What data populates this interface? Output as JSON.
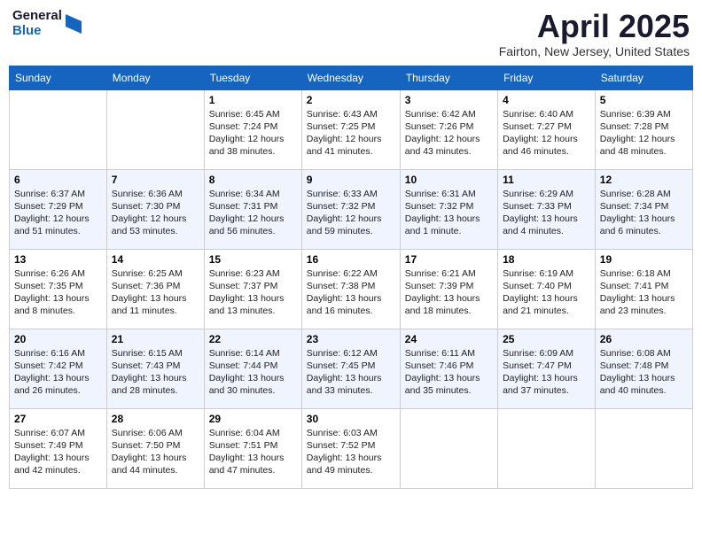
{
  "header": {
    "logo_general": "General",
    "logo_blue": "Blue",
    "title": "April 2025",
    "location": "Fairton, New Jersey, United States"
  },
  "days_of_week": [
    "Sunday",
    "Monday",
    "Tuesday",
    "Wednesday",
    "Thursday",
    "Friday",
    "Saturday"
  ],
  "weeks": [
    [
      {
        "day": "",
        "sunrise": "",
        "sunset": "",
        "daylight": ""
      },
      {
        "day": "",
        "sunrise": "",
        "sunset": "",
        "daylight": ""
      },
      {
        "day": "1",
        "sunrise": "Sunrise: 6:45 AM",
        "sunset": "Sunset: 7:24 PM",
        "daylight": "Daylight: 12 hours and 38 minutes."
      },
      {
        "day": "2",
        "sunrise": "Sunrise: 6:43 AM",
        "sunset": "Sunset: 7:25 PM",
        "daylight": "Daylight: 12 hours and 41 minutes."
      },
      {
        "day": "3",
        "sunrise": "Sunrise: 6:42 AM",
        "sunset": "Sunset: 7:26 PM",
        "daylight": "Daylight: 12 hours and 43 minutes."
      },
      {
        "day": "4",
        "sunrise": "Sunrise: 6:40 AM",
        "sunset": "Sunset: 7:27 PM",
        "daylight": "Daylight: 12 hours and 46 minutes."
      },
      {
        "day": "5",
        "sunrise": "Sunrise: 6:39 AM",
        "sunset": "Sunset: 7:28 PM",
        "daylight": "Daylight: 12 hours and 48 minutes."
      }
    ],
    [
      {
        "day": "6",
        "sunrise": "Sunrise: 6:37 AM",
        "sunset": "Sunset: 7:29 PM",
        "daylight": "Daylight: 12 hours and 51 minutes."
      },
      {
        "day": "7",
        "sunrise": "Sunrise: 6:36 AM",
        "sunset": "Sunset: 7:30 PM",
        "daylight": "Daylight: 12 hours and 53 minutes."
      },
      {
        "day": "8",
        "sunrise": "Sunrise: 6:34 AM",
        "sunset": "Sunset: 7:31 PM",
        "daylight": "Daylight: 12 hours and 56 minutes."
      },
      {
        "day": "9",
        "sunrise": "Sunrise: 6:33 AM",
        "sunset": "Sunset: 7:32 PM",
        "daylight": "Daylight: 12 hours and 59 minutes."
      },
      {
        "day": "10",
        "sunrise": "Sunrise: 6:31 AM",
        "sunset": "Sunset: 7:32 PM",
        "daylight": "Daylight: 13 hours and 1 minute."
      },
      {
        "day": "11",
        "sunrise": "Sunrise: 6:29 AM",
        "sunset": "Sunset: 7:33 PM",
        "daylight": "Daylight: 13 hours and 4 minutes."
      },
      {
        "day": "12",
        "sunrise": "Sunrise: 6:28 AM",
        "sunset": "Sunset: 7:34 PM",
        "daylight": "Daylight: 13 hours and 6 minutes."
      }
    ],
    [
      {
        "day": "13",
        "sunrise": "Sunrise: 6:26 AM",
        "sunset": "Sunset: 7:35 PM",
        "daylight": "Daylight: 13 hours and 8 minutes."
      },
      {
        "day": "14",
        "sunrise": "Sunrise: 6:25 AM",
        "sunset": "Sunset: 7:36 PM",
        "daylight": "Daylight: 13 hours and 11 minutes."
      },
      {
        "day": "15",
        "sunrise": "Sunrise: 6:23 AM",
        "sunset": "Sunset: 7:37 PM",
        "daylight": "Daylight: 13 hours and 13 minutes."
      },
      {
        "day": "16",
        "sunrise": "Sunrise: 6:22 AM",
        "sunset": "Sunset: 7:38 PM",
        "daylight": "Daylight: 13 hours and 16 minutes."
      },
      {
        "day": "17",
        "sunrise": "Sunrise: 6:21 AM",
        "sunset": "Sunset: 7:39 PM",
        "daylight": "Daylight: 13 hours and 18 minutes."
      },
      {
        "day": "18",
        "sunrise": "Sunrise: 6:19 AM",
        "sunset": "Sunset: 7:40 PM",
        "daylight": "Daylight: 13 hours and 21 minutes."
      },
      {
        "day": "19",
        "sunrise": "Sunrise: 6:18 AM",
        "sunset": "Sunset: 7:41 PM",
        "daylight": "Daylight: 13 hours and 23 minutes."
      }
    ],
    [
      {
        "day": "20",
        "sunrise": "Sunrise: 6:16 AM",
        "sunset": "Sunset: 7:42 PM",
        "daylight": "Daylight: 13 hours and 26 minutes."
      },
      {
        "day": "21",
        "sunrise": "Sunrise: 6:15 AM",
        "sunset": "Sunset: 7:43 PM",
        "daylight": "Daylight: 13 hours and 28 minutes."
      },
      {
        "day": "22",
        "sunrise": "Sunrise: 6:14 AM",
        "sunset": "Sunset: 7:44 PM",
        "daylight": "Daylight: 13 hours and 30 minutes."
      },
      {
        "day": "23",
        "sunrise": "Sunrise: 6:12 AM",
        "sunset": "Sunset: 7:45 PM",
        "daylight": "Daylight: 13 hours and 33 minutes."
      },
      {
        "day": "24",
        "sunrise": "Sunrise: 6:11 AM",
        "sunset": "Sunset: 7:46 PM",
        "daylight": "Daylight: 13 hours and 35 minutes."
      },
      {
        "day": "25",
        "sunrise": "Sunrise: 6:09 AM",
        "sunset": "Sunset: 7:47 PM",
        "daylight": "Daylight: 13 hours and 37 minutes."
      },
      {
        "day": "26",
        "sunrise": "Sunrise: 6:08 AM",
        "sunset": "Sunset: 7:48 PM",
        "daylight": "Daylight: 13 hours and 40 minutes."
      }
    ],
    [
      {
        "day": "27",
        "sunrise": "Sunrise: 6:07 AM",
        "sunset": "Sunset: 7:49 PM",
        "daylight": "Daylight: 13 hours and 42 minutes."
      },
      {
        "day": "28",
        "sunrise": "Sunrise: 6:06 AM",
        "sunset": "Sunset: 7:50 PM",
        "daylight": "Daylight: 13 hours and 44 minutes."
      },
      {
        "day": "29",
        "sunrise": "Sunrise: 6:04 AM",
        "sunset": "Sunset: 7:51 PM",
        "daylight": "Daylight: 13 hours and 47 minutes."
      },
      {
        "day": "30",
        "sunrise": "Sunrise: 6:03 AM",
        "sunset": "Sunset: 7:52 PM",
        "daylight": "Daylight: 13 hours and 49 minutes."
      },
      {
        "day": "",
        "sunrise": "",
        "sunset": "",
        "daylight": ""
      },
      {
        "day": "",
        "sunrise": "",
        "sunset": "",
        "daylight": ""
      },
      {
        "day": "",
        "sunrise": "",
        "sunset": "",
        "daylight": ""
      }
    ]
  ]
}
